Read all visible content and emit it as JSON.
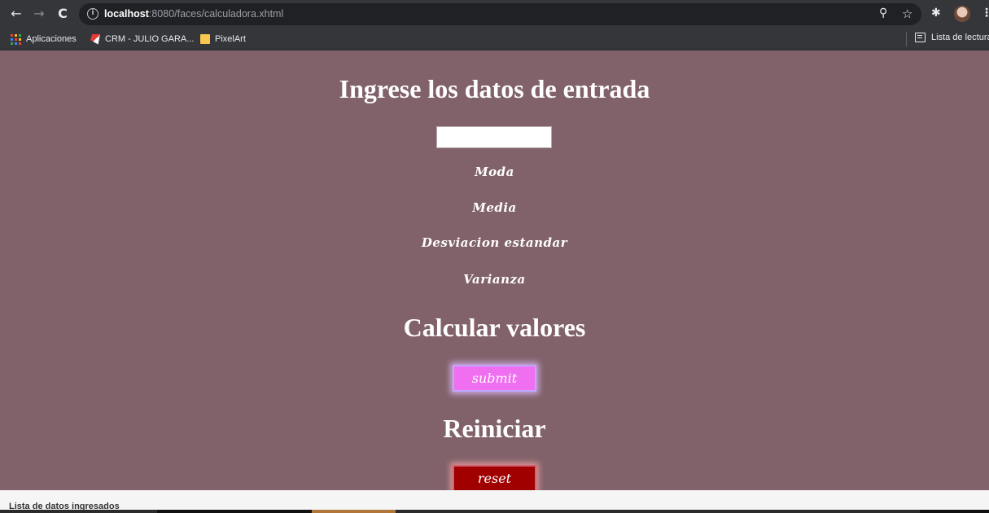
{
  "browser": {
    "url_host": "localhost",
    "url_path": ":8080/faces/calculadora.xhtml",
    "bookmarks": [
      {
        "label": "Aplicaciones",
        "icon": "apps-grid-icon"
      },
      {
        "label": "CRM - JULIO GARA...",
        "icon": "crm-favicon-icon"
      },
      {
        "label": "PixelArt",
        "icon": "folder-icon"
      }
    ],
    "reading_list": "Lista de lectura",
    "icons": {
      "back": "←",
      "forward": "→",
      "reload": "C",
      "info": "i",
      "zoom": "⚲",
      "star": "☆",
      "extensions": "✱",
      "menu": "⋮"
    }
  },
  "page": {
    "background": "#81626a",
    "entry_heading": "Ingrese los datos de entrada",
    "data_input": {
      "value": "",
      "placeholder": ""
    },
    "stats": {
      "moda": "Moda",
      "media": "Media",
      "desviacion": "Desviacion estandar",
      "varianza": "Varianza"
    },
    "calc_heading": "Calcular valores",
    "submit_label": "submit",
    "reset_heading": "Reiniciar",
    "reset_label": "reset"
  },
  "footer": {
    "list_label": "Lista de datos ingresados"
  },
  "colors": {
    "submit_button": "#f06ef0",
    "reset_button": "#a00000",
    "browser_chrome": "#35363a"
  }
}
